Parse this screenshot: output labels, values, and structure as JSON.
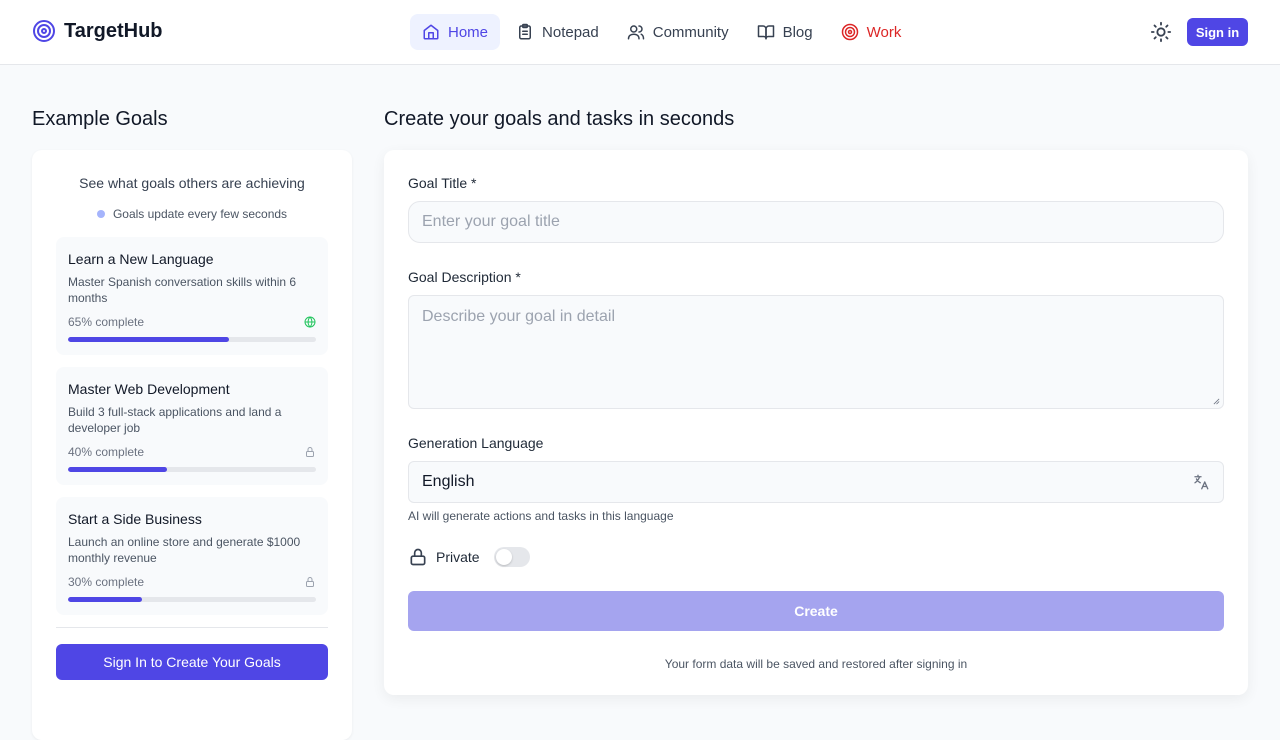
{
  "app": {
    "name": "TargetHub"
  },
  "nav": {
    "items": [
      {
        "label": "Home",
        "icon": "home-icon"
      },
      {
        "label": "Notepad",
        "icon": "notepad-icon"
      },
      {
        "label": "Community",
        "icon": "users-icon"
      },
      {
        "label": "Blog",
        "icon": "book-icon"
      },
      {
        "label": "Work",
        "icon": "target-icon"
      }
    ],
    "active": "Home",
    "theme_icon": "sun-icon",
    "signin_label": "Sign in"
  },
  "left": {
    "title": "Example Goals",
    "subtitle": "See what goals others are achieving",
    "live_text": "Goals update every few seconds",
    "goals": [
      {
        "title": "Learn a New Language",
        "description": "Master Spanish conversation skills within 6 months",
        "progress_text": "65% complete",
        "progress": 65,
        "visibility_icon": "globe-icon"
      },
      {
        "title": "Master Web Development",
        "description": "Build 3 full-stack applications and land a developer job",
        "progress_text": "40% complete",
        "progress": 40,
        "visibility_icon": "lock-icon"
      },
      {
        "title": "Start a Side Business",
        "description": "Launch an online store and generate $1000 monthly revenue",
        "progress_text": "30% complete",
        "progress": 30,
        "visibility_icon": "lock-icon"
      }
    ],
    "cta_label": "Sign In to Create Your Goals"
  },
  "form": {
    "heading": "Create your goals and tasks in seconds",
    "title_label": "Goal Title *",
    "title_placeholder": "Enter your goal title",
    "description_label": "Goal Description *",
    "description_placeholder": "Describe your goal in detail",
    "language_label": "Generation Language",
    "language_value": "English",
    "language_help": "AI will generate actions and tasks in this language",
    "private_label": "Private",
    "private_on": false,
    "create_label": "Create",
    "note": "Your form data will be saved and restored after signing in"
  },
  "colors": {
    "accent": "#4f46e5",
    "accent_disabled": "#a5a4ef",
    "work": "#dc2626",
    "public": "#22c55e"
  }
}
